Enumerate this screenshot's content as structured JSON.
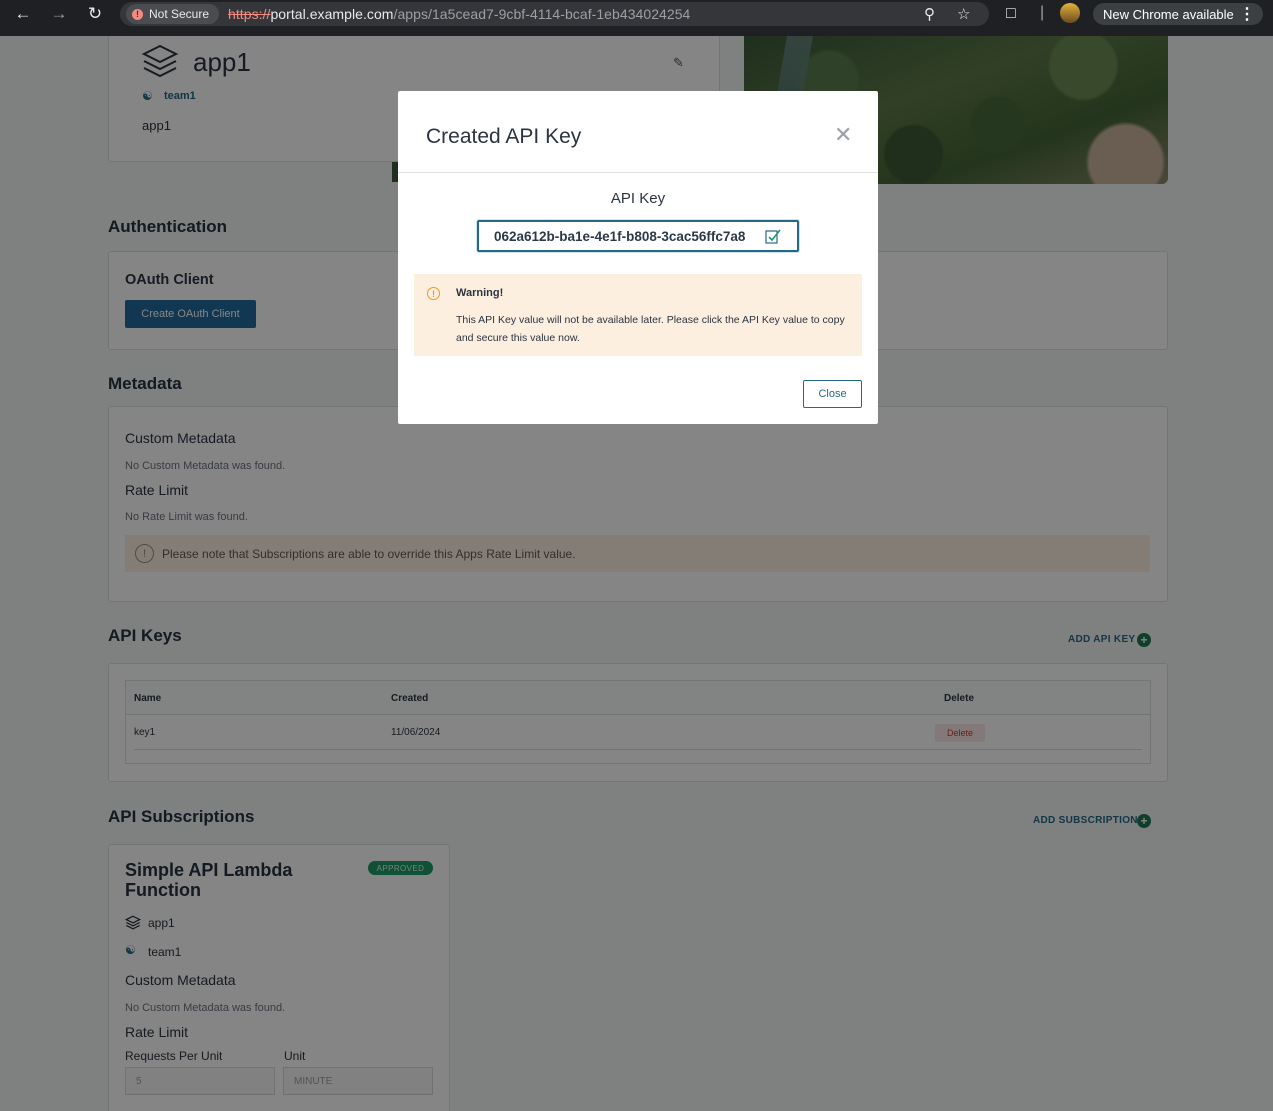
{
  "browser": {
    "not_secure": "Not Secure",
    "url_scheme": "https://",
    "url_host": "portal.example.com",
    "url_path": "/apps/1a5cead7-9cbf-4114-bcaf-1eb434024254",
    "update_button": "New Chrome available"
  },
  "app": {
    "name": "app1",
    "team": "team1",
    "description": "app1"
  },
  "authentication": {
    "section_title": "Authentication",
    "oauth_title": "OAuth Client",
    "create_oauth_button": "Create OAuth Client"
  },
  "metadata": {
    "section_title": "Metadata",
    "custom_title": "Custom Metadata",
    "custom_empty": "No Custom Metadata was found.",
    "rate_limit_title": "Rate Limit",
    "rate_limit_empty": "No Rate Limit was found.",
    "notice": "Please note that Subscriptions are able to override this Apps Rate Limit value."
  },
  "api_keys": {
    "section_title": "API Keys",
    "add_button": "ADD API KEY",
    "columns": [
      "Name",
      "Created",
      "Delete"
    ],
    "rows": [
      {
        "name": "key1",
        "created": "11/06/2024",
        "action": "Delete"
      }
    ]
  },
  "subscriptions": {
    "section_title": "API Subscriptions",
    "add_button": "ADD SUBSCRIPTION",
    "card": {
      "title_line1": "Simple API Lambda",
      "title_line2": "Function",
      "status": "APPROVED",
      "app": "app1",
      "team": "team1",
      "custom_title": "Custom Metadata",
      "custom_empty": "No Custom Metadata was found.",
      "rate_limit_title": "Rate Limit",
      "requests_label": "Requests Per Unit",
      "unit_label": "Unit",
      "requests_value": "5",
      "unit_value": "MINUTE"
    }
  },
  "modal": {
    "title": "Created API Key",
    "key_label": "API Key",
    "key_value": "062a612b-ba1e-4e1f-b808-3cac56ffc7a8",
    "warning_title": "Warning!",
    "warning_text": "This API Key value will not be available later. Please click the API Key value to copy and secure this value now.",
    "close_button": "Close"
  },
  "colors": {
    "accent": "#246a86",
    "primary_button": "#246a9d",
    "approved_badge": "#1e9b64",
    "warning_bg": "#fdefe0"
  }
}
